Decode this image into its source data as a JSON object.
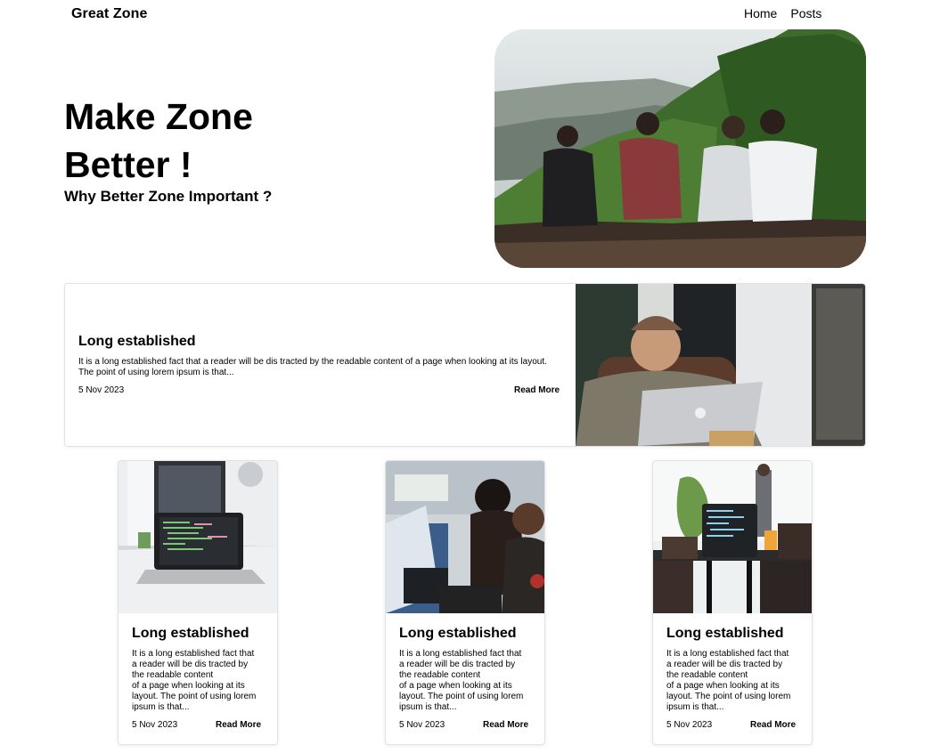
{
  "nav": {
    "brand": "Great Zone",
    "links": [
      "Home",
      "Posts"
    ]
  },
  "hero": {
    "title_line1": "Make Zone",
    "title_line2": "Better !",
    "subtitle": "Why Better Zone Important ?"
  },
  "featured": {
    "title": "Long established",
    "text": "It is a long established fact that a reader will be dis tracted by the readable content of a page when looking at its layout. The point of using lorem ipsum is that...",
    "date": "5 Nov 2023",
    "read_more": "Read More"
  },
  "cards": [
    {
      "title": "Long established",
      "text_lines": [
        "It is a long established fact that",
        "a reader will be dis tracted by",
        "the readable content",
        "of a page when looking at its",
        "layout. The point of using lorem",
        "ipsum is that..."
      ],
      "date": "5 Nov 2023",
      "read_more": "Read More"
    },
    {
      "title": "Long established",
      "text_lines": [
        "It is a long established fact that",
        "a reader will be dis tracted by",
        "the readable content",
        "of a page when looking at its",
        "layout. The point of using lorem",
        "ipsum is that..."
      ],
      "date": "5 Nov 2023",
      "read_more": "Read More"
    },
    {
      "title": "Long established",
      "text_lines": [
        "It is a long established fact that",
        "a reader will be dis tracted by",
        "the readable content",
        "of a page when looking at its",
        "layout. The point of using lorem",
        "ipsum is that..."
      ],
      "date": "5 Nov 2023",
      "read_more": "Read More"
    }
  ],
  "images": {
    "hero": "hero-friends-mountain-photo",
    "featured": "man-with-laptop-photo",
    "card1": "laptop-on-desk-photo",
    "card2": "people-at-computers-photo",
    "card3": "laptop-in-cafe-photo"
  }
}
